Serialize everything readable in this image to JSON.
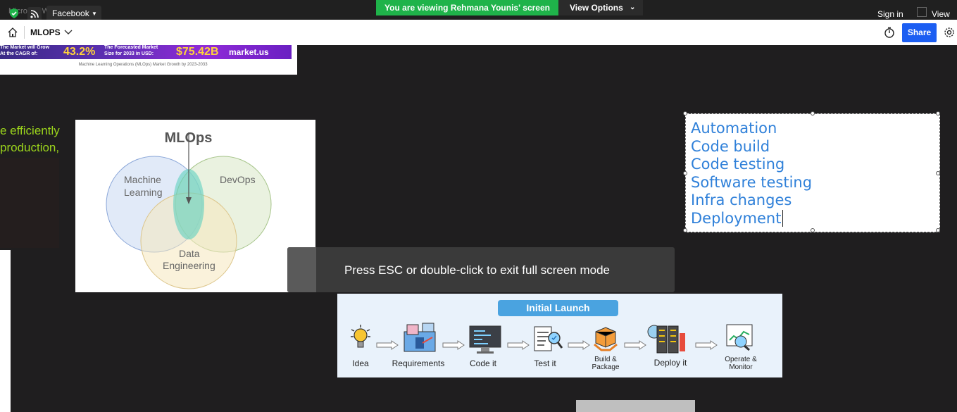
{
  "screen_share": {
    "banner": "You are viewing Rehmana Younis' screen",
    "view_options": "View Options"
  },
  "browser": {
    "background_title": "Microsoft Whiteboard",
    "facebook_chip": "Facebook",
    "sign_in": "Sign in",
    "view": "View"
  },
  "toolbar": {
    "board_title": "MLOPS",
    "share_button": "Share"
  },
  "market_banner": {
    "cagr_line1": "The Market will Grow",
    "cagr_line2": "At the CAGR of:",
    "cagr_value": "43.2%",
    "forecast_line1": "The Forecasted Market",
    "forecast_line2": "Size for 2033 in USD:",
    "forecast_value": "$75.42B",
    "brand": "market.us",
    "caption": "Machine Learning Operations (MLOps) Market Growth by 2023-2033"
  },
  "left_text": {
    "line1": "e efficiently",
    "line2": "production,"
  },
  "venn": {
    "title": "MLOps",
    "circle_ml_line1": "Machine",
    "circle_ml_line2": "Learning",
    "circle_devops": "DevOps",
    "circle_de_line1": "Data",
    "circle_de_line2": "Engineering"
  },
  "toast": {
    "message": "Press ESC or double-click to exit full screen mode"
  },
  "textbox": {
    "lines": [
      "Automation",
      "Code build",
      "Code testing",
      "Software testing",
      "Infra changes",
      "Deployment"
    ]
  },
  "pipeline": {
    "header": "Initial Launch",
    "steps": [
      {
        "label": "Idea",
        "icon": "lightbulb-icon"
      },
      {
        "label": "Requirements",
        "icon": "requirements-icon"
      },
      {
        "label": "Code it",
        "icon": "monitor-code-icon"
      },
      {
        "label": "Test it",
        "icon": "test-magnifier-icon"
      },
      {
        "label": "Build & Package",
        "line1": "Build &",
        "line2": "Package",
        "icon": "package-icon"
      },
      {
        "label": "Deploy it",
        "icon": "server-deploy-icon"
      },
      {
        "label": "Operate & Monitor",
        "line1": "Operate &",
        "line2": "Monitor",
        "icon": "monitor-chart-icon"
      }
    ]
  },
  "colors": {
    "accent_share": "#1c5ef2",
    "screen_share_green": "#1fb34a",
    "textbox_blue": "#2f80d9",
    "left_text_green": "#9bd41c"
  }
}
